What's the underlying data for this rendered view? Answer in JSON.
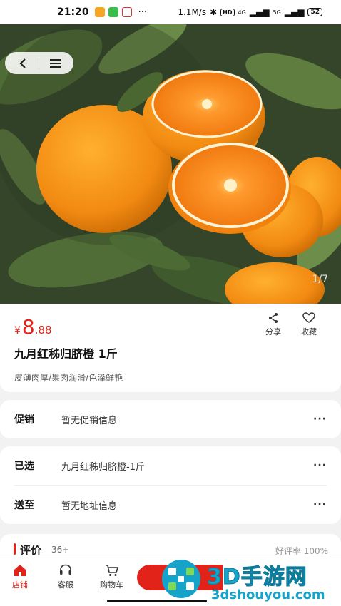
{
  "status_bar": {
    "time": "21:20",
    "net_speed": "1.1M/s",
    "hd_label": "HD",
    "sig1": "4G",
    "sig2": "5G",
    "battery": "52"
  },
  "gallery": {
    "counter": "1/7"
  },
  "product": {
    "currency": "¥",
    "price_int": "8",
    "price_dec": ".88",
    "title": "九月红秭归脐橙 1斤",
    "subtitle": "皮薄肉厚/果肉润滑/色泽鲜艳",
    "share_label": "分享",
    "fav_label": "收藏"
  },
  "promo": {
    "label": "促销",
    "value": "暂无促销信息",
    "more": "···"
  },
  "selected": {
    "label": "已选",
    "value": "九月红秭归脐橙-1斤",
    "more": "···"
  },
  "delivery": {
    "label": "送至",
    "value": "暂无地址信息",
    "more": "···"
  },
  "review": {
    "label": "评价",
    "count": "36+",
    "rate": "好评率 100%"
  },
  "bottom_nav": {
    "store": "店铺",
    "service": "客服",
    "cart": "购物车"
  },
  "watermark": {
    "big": "3D手游网",
    "small": "3dshouyou.com"
  },
  "colors": {
    "accent": "#e2231a",
    "orange": "#f28a12",
    "watermark": "#16a3c9"
  }
}
